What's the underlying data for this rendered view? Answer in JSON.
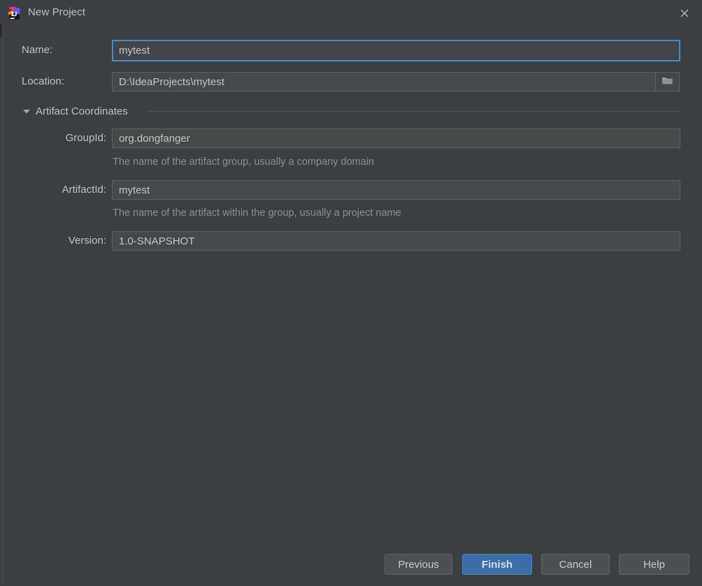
{
  "window": {
    "title": "New Project",
    "logo_icon": "intellij-idea-logo",
    "close_icon": "close-icon"
  },
  "form": {
    "name": {
      "label": "Name:",
      "value": "mytest",
      "placeholder": "",
      "focused": true
    },
    "location": {
      "label": "Location:",
      "value": "D:\\IdeaProjects\\mytest",
      "placeholder": "",
      "browse_icon": "folder-icon"
    },
    "artifact_section": {
      "title": "Artifact Coordinates",
      "expanded": true,
      "twisty_icon": "chevron-down-icon",
      "fields": [
        {
          "label": "GroupId:",
          "value": "org.dongfanger",
          "hint": "The name of the artifact group, usually a company domain"
        },
        {
          "label": "ArtifactId:",
          "value": "mytest",
          "hint": "The name of the artifact within the group, usually a project name"
        },
        {
          "label": "Version:",
          "value": "1.0-SNAPSHOT",
          "hint": ""
        }
      ]
    }
  },
  "buttons": {
    "previous": "Previous",
    "finish": "Finish",
    "cancel": "Cancel",
    "help": "Help"
  },
  "colors": {
    "background": "#3c3f41",
    "field_background": "#45494a",
    "field_border": "#5c6061",
    "focus_border": "#4a88c7",
    "default_button": "#3b6ea8",
    "text": "#bfbfbf",
    "hint_text": "#8a8f90"
  }
}
